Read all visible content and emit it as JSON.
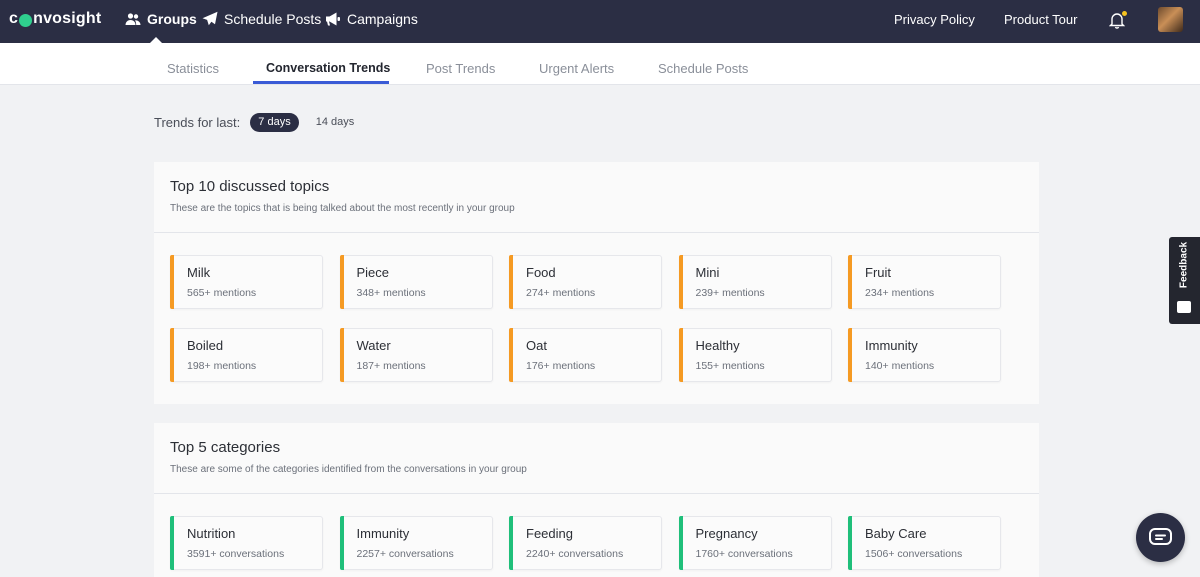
{
  "topnav": {
    "logo": {
      "prefix": "c",
      "suffix": "nvosight"
    },
    "items": [
      {
        "label": "Groups",
        "icon": "users-icon"
      },
      {
        "label": "Schedule Posts",
        "icon": "paper-plane-icon"
      },
      {
        "label": "Campaigns",
        "icon": "megaphone-icon"
      }
    ],
    "right": {
      "privacy": "Privacy Policy",
      "tour": "Product Tour"
    }
  },
  "subtabs": [
    {
      "label": "Statistics"
    },
    {
      "label": "Conversation Trends"
    },
    {
      "label": "Post Trends"
    },
    {
      "label": "Urgent Alerts"
    },
    {
      "label": "Schedule Posts"
    }
  ],
  "trends": {
    "label": "Trends for last:",
    "options": [
      "7 days",
      "14 days"
    ],
    "selected": "7 days"
  },
  "topics": {
    "title": "Top 10 discussed topics",
    "subtitle": "These are the topics that is being talked about the most recently in your group",
    "accent": "#f59a23",
    "items": [
      {
        "name": "Milk",
        "count": "565+ mentions"
      },
      {
        "name": "Piece",
        "count": "348+ mentions"
      },
      {
        "name": "Food",
        "count": "274+ mentions"
      },
      {
        "name": "Mini",
        "count": "239+ mentions"
      },
      {
        "name": "Fruit",
        "count": "234+ mentions"
      },
      {
        "name": "Boiled",
        "count": "198+ mentions"
      },
      {
        "name": "Water",
        "count": "187+ mentions"
      },
      {
        "name": "Oat",
        "count": "176+ mentions"
      },
      {
        "name": "Healthy",
        "count": "155+ mentions"
      },
      {
        "name": "Immunity",
        "count": "140+ mentions"
      }
    ]
  },
  "categories": {
    "title": "Top 5 categories",
    "subtitle": "These are some of the categories identified from the conversations in your group",
    "accent": "#1fbf7a",
    "items": [
      {
        "name": "Nutrition",
        "count": "3591+ conversations"
      },
      {
        "name": "Immunity",
        "count": "2257+ conversations"
      },
      {
        "name": "Feeding",
        "count": "2240+ conversations"
      },
      {
        "name": "Pregnancy",
        "count": "1760+ conversations"
      },
      {
        "name": "Baby Care",
        "count": "1506+ conversations"
      }
    ]
  },
  "feedback": {
    "label": "Feedback"
  },
  "colors": {
    "nav_bg": "#2b2e44",
    "tab_active": "#3a5bd6"
  }
}
